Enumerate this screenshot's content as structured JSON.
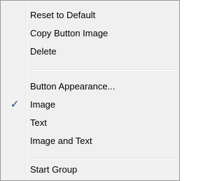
{
  "menu": {
    "items": [
      {
        "label": "Reset to Default"
      },
      {
        "label": "Copy Button Image"
      },
      {
        "label": "Delete"
      },
      {
        "label": "Button Appearance..."
      },
      {
        "label": "Image",
        "checked": true,
        "check_glyph": "✓"
      },
      {
        "label": "Text"
      },
      {
        "label": "Image and Text"
      },
      {
        "label": "Start Group"
      }
    ],
    "check_icon": "checkmark-icon",
    "accent_color": "#1d3e8d"
  }
}
